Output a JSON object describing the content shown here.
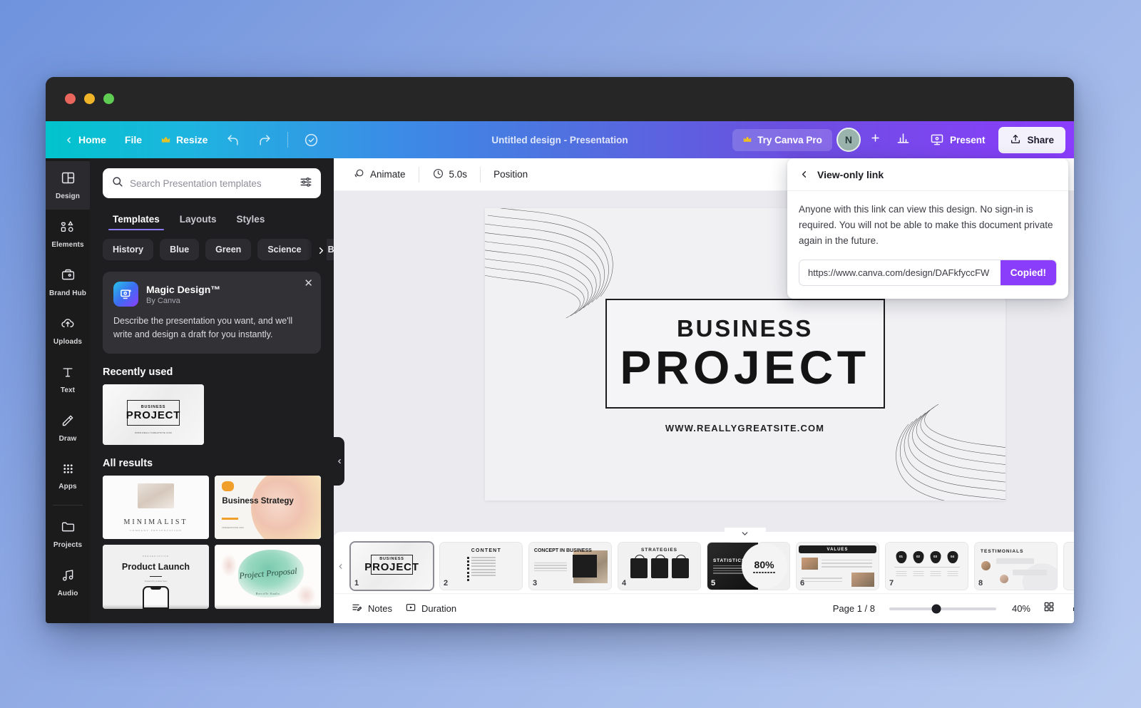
{
  "window": {
    "traffic_lights": [
      "close",
      "minimize",
      "maximize"
    ]
  },
  "appbar": {
    "back_icon": "chevron-left-icon",
    "home_label": "Home",
    "file_label": "File",
    "resize_label": "Resize",
    "resize_icon": "crown-icon",
    "undo_icon": "undo-icon",
    "redo_icon": "redo-icon",
    "cloud_saved_icon": "cloud-check-icon",
    "doc_title": "Untitled design - Presentation",
    "pro_label": "Try Canva Pro",
    "pro_icon": "crown-icon",
    "avatar_initial": "N",
    "add_collaborator_icon": "plus-icon",
    "insights_icon": "bar-chart-icon",
    "present_icon": "presentation-screen-icon",
    "present_label": "Present",
    "share_icon": "upload-icon",
    "share_label": "Share",
    "gradient_from": "#00c4cc",
    "gradient_to": "#8b3dfc"
  },
  "rail": {
    "items": [
      {
        "label": "Design",
        "icon": "layout-design-icon",
        "active": true
      },
      {
        "label": "Elements",
        "icon": "shapes-elements-icon",
        "active": false
      },
      {
        "label": "Brand Hub",
        "icon": "brand-hub-icon",
        "active": false
      },
      {
        "label": "Uploads",
        "icon": "cloud-upload-icon",
        "active": false
      },
      {
        "label": "Text",
        "icon": "text-t-icon",
        "active": false
      },
      {
        "label": "Draw",
        "icon": "pen-draw-icon",
        "active": false
      },
      {
        "label": "Apps",
        "icon": "grid-apps-icon",
        "active": false
      }
    ],
    "bottom_items": [
      {
        "label": "Projects",
        "icon": "folder-icon"
      },
      {
        "label": "Audio",
        "icon": "music-note-icon"
      }
    ]
  },
  "panel": {
    "search": {
      "placeholder": "Search Presentation templates",
      "value": "",
      "search_icon": "search-icon",
      "filter_icon": "sliders-filter-icon"
    },
    "tabs": [
      {
        "label": "Templates",
        "active": true
      },
      {
        "label": "Layouts",
        "active": false
      },
      {
        "label": "Styles",
        "active": false
      }
    ],
    "chips": [
      "History",
      "Blue",
      "Green",
      "Science",
      "Bus"
    ],
    "chip_next_icon": "chevron-right-icon",
    "magic_design": {
      "title": "Magic Design™",
      "subtitle": "By Canva",
      "description": "Describe the presentation you want, and we'll write and design a draft for you instantly.",
      "logo_icon": "magic-design-sparkle-icon",
      "close_icon": "close-x-icon"
    },
    "recently_used_title": "Recently used",
    "recent_template": {
      "line1": "BUSINESS",
      "line2": "PROJECT",
      "line3": "WWW.REALLYGREATSITE.COM"
    },
    "all_results_title": "All results",
    "results": [
      {
        "name": "minimalist-template",
        "title": "MINIMALIST",
        "subtitle": "COMPANY PRESENTATION"
      },
      {
        "name": "business-strategy-template",
        "title": "Business Strategy",
        "subtitle": "PRESENTATION 2024"
      },
      {
        "name": "product-launch-template",
        "title": "Product Launch",
        "eyebrow": "PRESENTATION",
        "subtitle": "Prepared by Creative Team"
      },
      {
        "name": "project-proposal-template",
        "title": "Project Proposal",
        "subtitle": "Borcelle Studio"
      }
    ],
    "collapse_icon": "chevron-left-icon"
  },
  "context_bar": {
    "animate_icon": "animate-icon",
    "animate_label": "Animate",
    "timer_icon": "clock-icon",
    "duration_label": "5.0s",
    "position_label": "Position"
  },
  "canvas": {
    "slide": {
      "line1": "BUSINESS",
      "line2": "PROJECT",
      "url": "WWW.REALLYGREATSITE.COM"
    },
    "ai_fab_icon": "sparkles-icon"
  },
  "share_popover": {
    "back_icon": "chevron-left-icon",
    "title": "View-only link",
    "description": "Anyone with this link can view this design. No sign-in is required. You will not be able to make this document private again in the future.",
    "link": "https://www.canva.com/design/DAFkfyccFW",
    "copied_label": "Copied!",
    "copied_color": "#8b3dfc"
  },
  "strip": {
    "collapse_icon": "chevron-down-icon",
    "prev_icon": "chevron-left-icon",
    "next_icon": "chevron-right-icon",
    "slides": [
      {
        "page": "1",
        "name": "slide-business-project",
        "title": "PROJECT",
        "eyebrow": "BUSINESS",
        "selected": true
      },
      {
        "page": "2",
        "name": "slide-content",
        "title": "CONTENT",
        "selected": false
      },
      {
        "page": "3",
        "name": "slide-concept-in-business",
        "title": "CONCEPT IN BUSINESS",
        "selected": false
      },
      {
        "page": "4",
        "name": "slide-strategies",
        "title": "STRATEGIES",
        "selected": false
      },
      {
        "page": "5",
        "name": "slide-statistics",
        "title": "STATISTICS",
        "stat": "80%",
        "selected": false
      },
      {
        "page": "6",
        "name": "slide-values",
        "title": "VALUES",
        "selected": false
      },
      {
        "page": "7",
        "name": "slide-timeline",
        "title": "",
        "markers": [
          "01",
          "02",
          "03",
          "04"
        ],
        "selected": false
      },
      {
        "page": "8",
        "name": "slide-testimonials",
        "title": "TESTIMONIALS",
        "selected": false
      }
    ]
  },
  "bottom_bar": {
    "notes_icon": "notes-icon",
    "notes_label": "Notes",
    "duration_icon": "duration-play-icon",
    "duration_label": "Duration",
    "page_indicator": "Page 1 / 8",
    "zoom_value": "40%",
    "grid_view_icon": "grid-view-icon",
    "fullscreen_icon": "expand-fullscreen-icon",
    "check_icon": "check-circle-icon",
    "help_icon": "help-question-icon"
  }
}
